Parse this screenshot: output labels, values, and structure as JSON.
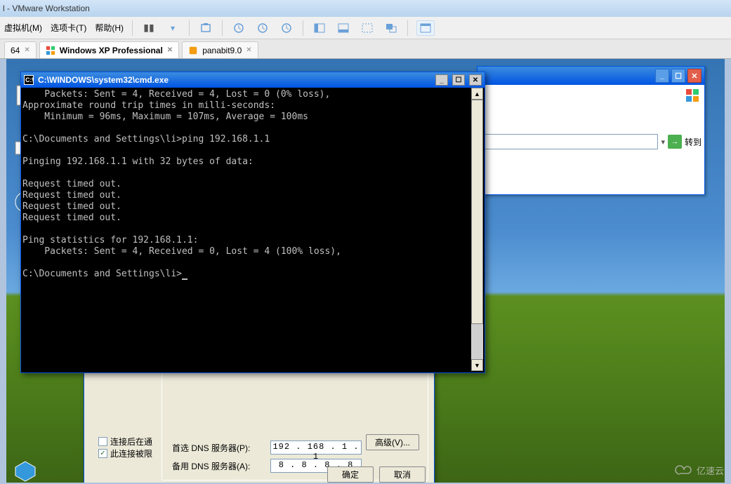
{
  "app": {
    "title": "l - VMware Workstation"
  },
  "menus": {
    "vm": "虚拟机(M)",
    "tabs": "选项卡(T)",
    "help": "帮助(H)"
  },
  "tabs": {
    "left": {
      "label": "64"
    },
    "active": {
      "label": "Windows XP Professional"
    },
    "right": {
      "label": "panabit9.0"
    }
  },
  "browser": {
    "go": "转到"
  },
  "cmd": {
    "title": "C:\\WINDOWS\\system32\\cmd.exe",
    "lines": [
      "    Packets: Sent = 4, Received = 4, Lost = 0 (0% loss),",
      "Approximate round trip times in milli-seconds:",
      "    Minimum = 96ms, Maximum = 107ms, Average = 100ms",
      "",
      "C:\\Documents and Settings\\li>ping 192.168.1.1",
      "",
      "Pinging 192.168.1.1 with 32 bytes of data:",
      "",
      "Request timed out.",
      "Request timed out.",
      "Request timed out.",
      "Request timed out.",
      "",
      "Ping statistics for 192.168.1.1:",
      "    Packets: Sent = 4, Received = 0, Lost = 4 (100% loss),",
      "",
      "C:\\Documents and Settings\\li>"
    ]
  },
  "tcpip": {
    "chk1": "连接后在通",
    "chk2": "此连接被限",
    "primary_dns_label": "首选 DNS 服务器(P):",
    "alt_dns_label": "备用 DNS 服务器(A):",
    "primary_dns": "192 . 168 .  1  .  1",
    "alt_dns": " 8  .  8  .  8  .  8",
    "advanced": "高级(V)...",
    "ok": "确定",
    "cancel": "取消"
  },
  "watermark": "亿速云"
}
